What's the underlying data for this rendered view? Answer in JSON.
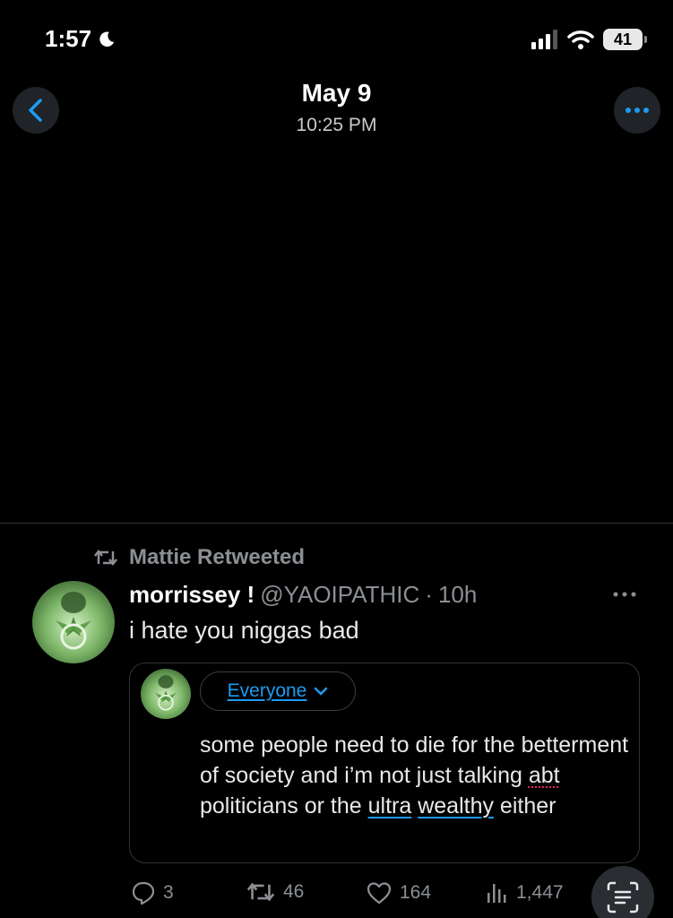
{
  "status_bar": {
    "time": "1:57",
    "battery": "41",
    "icons": [
      "moon-icon",
      "signal-icon",
      "wifi-icon",
      "battery-icon"
    ]
  },
  "header": {
    "title": "May 9",
    "subtitle": "10:25 PM",
    "back_icon": "chevron-left-icon",
    "more_icon": "ellipsis-icon"
  },
  "tweet": {
    "retweeted_by": "Mattie Retweeted",
    "display_name": "morrissey !",
    "handle": "@YAOIPATHIC",
    "separator": "·",
    "time": "10h",
    "text": "i hate you niggas bad",
    "quote": {
      "audience": "Everyone",
      "text_parts": {
        "p1": "some people need to die for the betterment of society and i’m not just talking ",
        "spell": "abt",
        "p2": " politicians or the ",
        "link1": "ultra",
        "p3": " ",
        "link2": "wealthy",
        "p4": " either"
      }
    },
    "actions": {
      "replies": "3",
      "retweets": "46",
      "likes": "164",
      "views": "1,447"
    }
  },
  "colors": {
    "background": "#000000",
    "accent": "#1d9bf0",
    "muted": "#8b8f94",
    "divider": "#2f3336"
  }
}
